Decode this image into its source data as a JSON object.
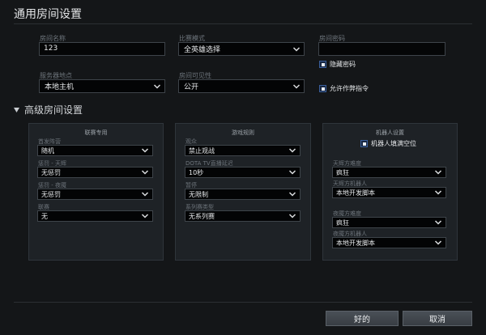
{
  "title": "通用房间设置",
  "general": {
    "room_name_label": "房间名称",
    "room_name_value": "123",
    "game_mode_label": "比赛模式",
    "game_mode_value": "全英雄选择",
    "password_label": "房间密码",
    "password_value": "",
    "hide_password_label": "隐藏密码",
    "hide_password_checked": true,
    "server_label": "服务器地点",
    "server_value": "本地主机",
    "visibility_label": "房间可见性",
    "visibility_value": "公开",
    "cheats_label": "允许作弊指令",
    "cheats_checked": true
  },
  "advanced": {
    "title": "高级房间设置",
    "league": {
      "title": "联赛专用",
      "fields": [
        {
          "label": "首发阵营",
          "value": "随机"
        },
        {
          "label": "惩罚 - 天辉",
          "value": "无惩罚"
        },
        {
          "label": "惩罚 - 夜魇",
          "value": "无惩罚"
        },
        {
          "label": "联赛",
          "value": "无"
        }
      ]
    },
    "rules": {
      "title": "游戏规则",
      "fields": [
        {
          "label": "观众",
          "value": "禁止观战"
        },
        {
          "label": "DOTA TV直播延迟",
          "value": "10秒"
        },
        {
          "label": "暂停",
          "value": "无限制"
        },
        {
          "label": "系列赛类型",
          "value": "无系列赛"
        }
      ]
    },
    "bots": {
      "title": "机器人设置",
      "fill_label": "机器人填满空位",
      "fill_checked": true,
      "fields": [
        {
          "label": "天辉方难度",
          "value": "疯狂"
        },
        {
          "label": "天辉方机器人",
          "value": "本地开发脚本"
        },
        {
          "label": "夜魇方难度",
          "value": "疯狂"
        },
        {
          "label": "夜魇方机器人",
          "value": "本地开发脚本"
        }
      ]
    }
  },
  "buttons": {
    "ok": "好的",
    "cancel": "取消"
  }
}
